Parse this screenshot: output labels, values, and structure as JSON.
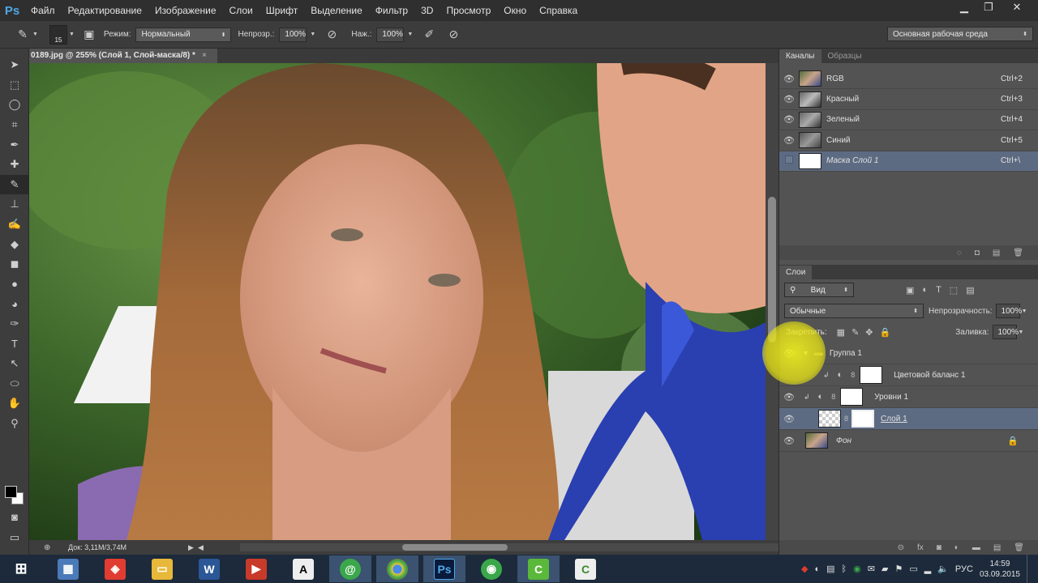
{
  "app": {
    "logo": "Ps"
  },
  "menu": [
    "Файл",
    "Редактирование",
    "Изображение",
    "Слои",
    "Шрифт",
    "Выделение",
    "Фильтр",
    "3D",
    "Просмотр",
    "Окно",
    "Справка"
  ],
  "options": {
    "brush_size": "15",
    "mode_label": "Режим:",
    "mode_value": "Нормальный",
    "opacity_label": "Непрозр.:",
    "opacity_value": "100%",
    "pressure_label": "Наж.:",
    "pressure_value": "100%",
    "workspace": "Основная рабочая среда"
  },
  "document": {
    "tab_title": "0189.jpg @ 255% (Слой 1, Слой-маска/8) *",
    "doc_info": "Док: 3,11M/3,74M"
  },
  "channels_panel": {
    "tabs": [
      "Каналы",
      "Образцы"
    ],
    "rows": [
      {
        "name": "RGB",
        "shortcut": "Ctrl+2"
      },
      {
        "name": "Красный",
        "shortcut": "Ctrl+3"
      },
      {
        "name": "Зеленый",
        "shortcut": "Ctrl+4"
      },
      {
        "name": "Синий",
        "shortcut": "Ctrl+5"
      },
      {
        "name": "Маска Слой 1",
        "shortcut": "Ctrl+\\"
      }
    ]
  },
  "layers_panel": {
    "title": "Слои",
    "filter": "Вид",
    "blend_mode": "Обычные",
    "opacity_label": "Непрозрачность:",
    "opacity_value": "100%",
    "lock_label": "Закрепить:",
    "fill_label": "Заливка:",
    "fill_value": "100%",
    "layers": [
      {
        "name": "Группа 1"
      },
      {
        "name": "Цветовой баланс 1"
      },
      {
        "name": "Уровни 1"
      },
      {
        "name": "Слой 1"
      },
      {
        "name": "Фон"
      }
    ]
  },
  "taskbar": {
    "apps": [
      "windows-start",
      "calculator",
      "chrome-store",
      "folder",
      "word",
      "media",
      "font",
      "mail",
      "chrome",
      "photoshop",
      "network",
      "camtasia-recorder",
      "camtasia-studio"
    ],
    "lang": "РУС",
    "time": "14:59",
    "date": "03.09.2015"
  }
}
